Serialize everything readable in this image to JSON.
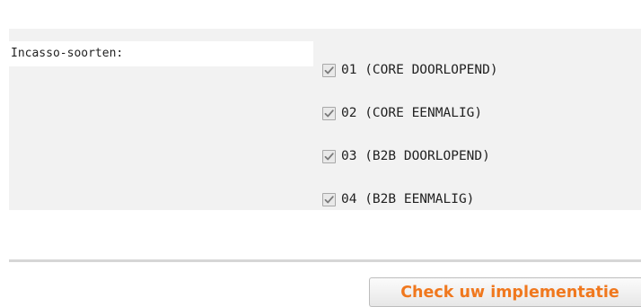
{
  "form": {
    "label": "Incasso-soorten:",
    "options": [
      {
        "label": "01 (CORE DOORLOPEND)",
        "checked": true
      },
      {
        "label": "02 (CORE EENMALIG)",
        "checked": true
      },
      {
        "label": "03 (B2B DOORLOPEND)",
        "checked": true
      },
      {
        "label": "04 (B2B EENMALIG)",
        "checked": true
      }
    ]
  },
  "actions": {
    "check_label": "Check uw implementatie"
  },
  "colors": {
    "panel_background": "#f2f2f2",
    "button_text": "#f0781e",
    "checkmark": "#7a7a7a"
  },
  "icons": {
    "checkbox": "checkmark-icon"
  }
}
